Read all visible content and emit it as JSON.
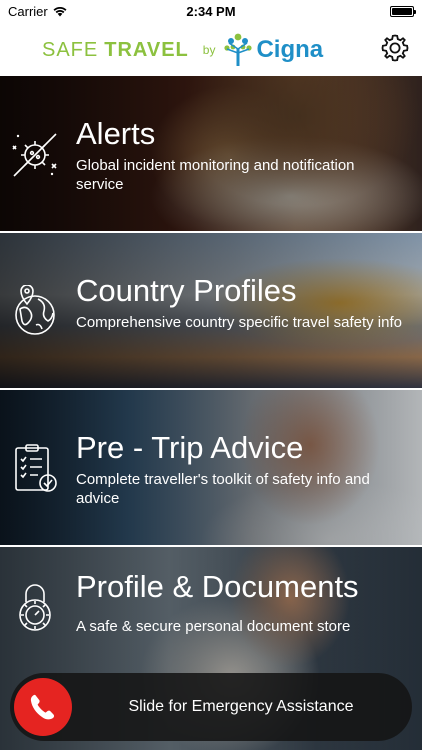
{
  "status_bar": {
    "carrier": "Carrier",
    "time": "2:34 PM"
  },
  "header": {
    "brand_safe": "SAFE",
    "brand_travel": "TRAVEL",
    "brand_by": "by",
    "brand_cigna": "Cigna",
    "settings_icon": "gear-icon"
  },
  "cards": [
    {
      "title": "Alerts",
      "description": "Global incident monitoring and notification service",
      "icon": "virus-alert-icon"
    },
    {
      "title": "Country Profiles",
      "description": "Comprehensive country specific travel safety info",
      "icon": "globe-pin-icon"
    },
    {
      "title": "Pre - Trip Advice",
      "description": "Complete traveller's toolkit of safety info and advice",
      "icon": "checklist-icon"
    },
    {
      "title": "Profile & Documents",
      "description": "A safe & secure personal document store",
      "icon": "padlock-icon"
    }
  ],
  "emergency": {
    "label": "Slide for Emergency Assistance",
    "icon": "phone-icon",
    "color": "#e52421"
  },
  "colors": {
    "brand_green": "#8cc13f",
    "brand_blue": "#1f8fc7"
  }
}
